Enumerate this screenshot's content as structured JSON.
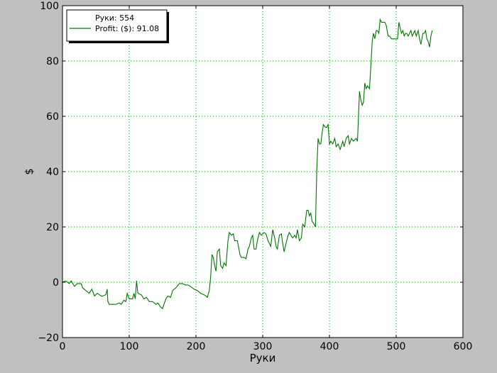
{
  "chart_data": {
    "type": "line",
    "title": "",
    "xlabel": "Руки",
    "ylabel": "$",
    "xlim": [
      0,
      600
    ],
    "ylim": [
      -20,
      100
    ],
    "x_ticks": [
      0,
      100,
      200,
      300,
      400,
      500,
      600
    ],
    "y_ticks": [
      -20,
      0,
      20,
      40,
      60,
      80,
      100
    ],
    "x_tick_labels": [
      "0",
      "100",
      "200",
      "300",
      "400",
      "500",
      "600"
    ],
    "y_tick_labels": [
      "−20",
      "0",
      "20",
      "40",
      "60",
      "80",
      "100"
    ],
    "grid": true,
    "legend_position": "top-left",
    "legend": {
      "hands_entry": "Руки: 554",
      "profit_entry": "Profit: ($): 91.08"
    },
    "colors": {
      "figure_background": "#c0c0c0",
      "plot_background": "#ffffff",
      "line": "#007700",
      "grid": "#00aa00"
    },
    "series": [
      {
        "name": "Profit: ($): 91.08",
        "points": [
          [
            0,
            0
          ],
          [
            5,
            0.5
          ],
          [
            10,
            -0.5
          ],
          [
            13,
            0.5
          ],
          [
            18,
            -1.5
          ],
          [
            22,
            -0.5
          ],
          [
            28,
            -0.5
          ],
          [
            30,
            -2
          ],
          [
            35,
            -3
          ],
          [
            40,
            -4
          ],
          [
            44,
            -2.5
          ],
          [
            48,
            -5
          ],
          [
            52,
            -4
          ],
          [
            58,
            -5
          ],
          [
            60,
            -5
          ],
          [
            65,
            -4.5
          ],
          [
            67,
            -2.5
          ],
          [
            68,
            -7
          ],
          [
            70,
            -8
          ],
          [
            75,
            -8
          ],
          [
            80,
            -8
          ],
          [
            85,
            -7.5
          ],
          [
            88,
            -8
          ],
          [
            92,
            -6.5
          ],
          [
            95,
            -7
          ],
          [
            97,
            -4
          ],
          [
            100,
            -6
          ],
          [
            105,
            -6
          ],
          [
            107,
            -4
          ],
          [
            109,
            -6
          ],
          [
            111,
            0.5
          ],
          [
            113,
            -4
          ],
          [
            118,
            -4.5
          ],
          [
            122,
            -6
          ],
          [
            126,
            -5.5
          ],
          [
            130,
            -7
          ],
          [
            135,
            -7
          ],
          [
            140,
            -8
          ],
          [
            143,
            -7.5
          ],
          [
            147,
            -9
          ],
          [
            150,
            -9.5
          ],
          [
            152,
            -8
          ],
          [
            155,
            -6
          ],
          [
            158,
            -5
          ],
          [
            162,
            -5.5
          ],
          [
            165,
            -3
          ],
          [
            170,
            -2
          ],
          [
            175,
            -0.5
          ],
          [
            180,
            -0.5
          ],
          [
            184,
            -1
          ],
          [
            188,
            -1
          ],
          [
            192,
            -1.5
          ],
          [
            197,
            -2.5
          ],
          [
            202,
            -3
          ],
          [
            207,
            -4
          ],
          [
            212,
            -4.5
          ],
          [
            215,
            -5
          ],
          [
            217,
            -5.5
          ],
          [
            220,
            -3
          ],
          [
            222,
            2
          ],
          [
            224,
            10
          ],
          [
            226,
            9
          ],
          [
            228,
            6
          ],
          [
            230,
            4
          ],
          [
            232,
            11
          ],
          [
            235,
            12
          ],
          [
            237,
            6
          ],
          [
            240,
            5
          ],
          [
            242,
            7
          ],
          [
            245,
            6
          ],
          [
            248,
            15
          ],
          [
            250,
            18
          ],
          [
            253,
            17
          ],
          [
            256,
            17.5
          ],
          [
            258,
            15
          ],
          [
            262,
            15
          ],
          [
            266,
            10
          ],
          [
            268,
            9
          ],
          [
            272,
            9
          ],
          [
            275,
            8.5
          ],
          [
            278,
            12
          ],
          [
            280,
            13
          ],
          [
            283,
            16
          ],
          [
            285,
            17
          ],
          [
            287,
            12
          ],
          [
            290,
            12
          ],
          [
            292,
            15
          ],
          [
            295,
            18
          ],
          [
            298,
            17
          ],
          [
            302,
            18
          ],
          [
            305,
            17.5
          ],
          [
            308,
            15
          ],
          [
            310,
            14
          ],
          [
            312,
            13
          ],
          [
            315,
            19
          ],
          [
            318,
            16
          ],
          [
            320,
            13
          ],
          [
            322,
            12
          ],
          [
            325,
            17
          ],
          [
            328,
            17.5
          ],
          [
            330,
            14
          ],
          [
            332,
            11
          ],
          [
            335,
            14
          ],
          [
            338,
            17
          ],
          [
            340,
            18
          ],
          [
            342,
            17
          ],
          [
            345,
            16
          ],
          [
            348,
            17
          ],
          [
            350,
            16
          ],
          [
            352,
            19
          ],
          [
            355,
            15
          ],
          [
            358,
            16
          ],
          [
            360,
            21
          ],
          [
            363,
            20
          ],
          [
            366,
            26
          ],
          [
            368,
            26
          ],
          [
            370,
            24
          ],
          [
            372,
            25
          ],
          [
            374,
            22
          ],
          [
            377,
            21
          ],
          [
            379,
            20
          ],
          [
            381,
            40
          ],
          [
            383,
            52
          ],
          [
            385,
            50
          ],
          [
            387,
            50
          ],
          [
            389,
            54
          ],
          [
            391,
            57
          ],
          [
            394,
            56
          ],
          [
            396,
            56
          ],
          [
            398,
            57
          ],
          [
            400,
            50
          ],
          [
            402,
            51
          ],
          [
            405,
            50
          ],
          [
            408,
            52
          ],
          [
            410,
            49
          ],
          [
            413,
            50
          ],
          [
            416,
            48
          ],
          [
            420,
            51
          ],
          [
            422,
            49
          ],
          [
            425,
            52
          ],
          [
            428,
            53
          ],
          [
            430,
            50
          ],
          [
            433,
            52
          ],
          [
            436,
            51
          ],
          [
            440,
            52
          ],
          [
            442,
            51
          ],
          [
            445,
            69
          ],
          [
            447,
            66
          ],
          [
            449,
            64
          ],
          [
            451,
            65
          ],
          [
            453,
            72
          ],
          [
            455,
            70
          ],
          [
            457,
            71
          ],
          [
            460,
            70
          ],
          [
            462,
            78
          ],
          [
            464,
            87
          ],
          [
            466,
            90
          ],
          [
            468,
            88
          ],
          [
            470,
            91
          ],
          [
            472,
            91
          ],
          [
            474,
            90
          ],
          [
            476,
            95
          ],
          [
            478,
            94
          ],
          [
            480,
            94
          ],
          [
            483,
            94
          ],
          [
            485,
            93
          ],
          [
            488,
            89
          ],
          [
            490,
            89
          ],
          [
            493,
            88
          ],
          [
            496,
            88
          ],
          [
            499,
            88
          ],
          [
            502,
            88
          ],
          [
            504,
            94
          ],
          [
            506,
            92
          ],
          [
            508,
            90
          ],
          [
            510,
            91
          ],
          [
            512,
            89
          ],
          [
            514,
            90
          ],
          [
            516,
            90
          ],
          [
            518,
            89
          ],
          [
            520,
            90
          ],
          [
            522,
            91
          ],
          [
            524,
            89
          ],
          [
            526,
            90
          ],
          [
            528,
            91
          ],
          [
            530,
            89
          ],
          [
            533,
            91
          ],
          [
            535,
            88
          ],
          [
            537,
            86
          ],
          [
            540,
            90
          ],
          [
            542,
            90
          ],
          [
            544,
            91
          ],
          [
            546,
            88
          ],
          [
            548,
            87
          ],
          [
            550,
            85
          ],
          [
            552,
            89
          ],
          [
            554,
            91.08
          ]
        ]
      }
    ]
  }
}
